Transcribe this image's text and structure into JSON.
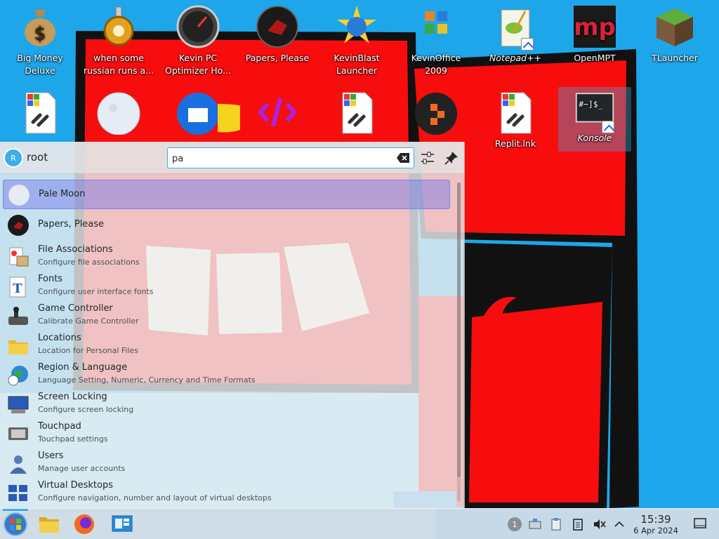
{
  "desktop": {
    "icons_row1": [
      {
        "label": "Big Money\nDeluxe",
        "icon": "money-bag-icon"
      },
      {
        "label": "when some\nrussian runs a...",
        "icon": "gear-settings-icon"
      },
      {
        "label": "Kevin PC\nOptimizer Ho...",
        "icon": "speedometer-icon"
      },
      {
        "label": "Papers, Please",
        "icon": "papers-please-icon"
      },
      {
        "label": "KevinBlast\nLauncher",
        "icon": "globe-star-icon"
      },
      {
        "label": "KevinOffice\n2009",
        "icon": "office-logo-icon"
      },
      {
        "label": "Notepad++",
        "icon": "notepad-plus-icon"
      },
      {
        "label": "OpenMPT",
        "icon": "openmpt-icon"
      },
      {
        "label": "TLauncher",
        "icon": "grass-block-icon"
      }
    ],
    "icons_row2": [
      {
        "label": "",
        "icon": "windows-link-file-icon"
      },
      {
        "label": "",
        "icon": "pale-moon-icon"
      },
      {
        "label": "",
        "icon": "thunderbird-icon"
      },
      {
        "label": "",
        "icon": "replit-logo-icon"
      },
      {
        "label": "",
        "icon": "windows-link-file-icon"
      },
      {
        "label": "",
        "icon": "orange-dots-app-icon"
      },
      {
        "label": "Replit.lnk",
        "icon": "windows-link-file-icon"
      },
      {
        "label": "Konsole",
        "icon": "terminal-icon"
      }
    ]
  },
  "launcher": {
    "user": {
      "name": "root",
      "initial": "R"
    },
    "search": {
      "value": "pa",
      "placeholder": "Search…"
    },
    "results": [
      {
        "title": "Pale Moon",
        "subtitle": "",
        "icon": "pale-moon-icon"
      },
      {
        "title": "Papers, Please",
        "subtitle": "",
        "icon": "papers-please-icon"
      },
      {
        "title": "File Associations",
        "subtitle": "Configure file associations",
        "icon": "file-associations-icon"
      },
      {
        "title": "Fonts",
        "subtitle": "Configure user interface fonts",
        "icon": "fonts-icon"
      },
      {
        "title": "Game Controller",
        "subtitle": "Calibrate Game Controller",
        "icon": "game-controller-icon"
      },
      {
        "title": "Locations",
        "subtitle": "Location for Personal Files",
        "icon": "folder-icon"
      },
      {
        "title": "Region & Language",
        "subtitle": "Language Setting, Numeric, Currency and Time Formats",
        "icon": "globe-clock-icon"
      },
      {
        "title": "Screen Locking",
        "subtitle": "Configure screen locking",
        "icon": "screen-lock-icon"
      },
      {
        "title": "Touchpad",
        "subtitle": "Touchpad settings",
        "icon": "touchpad-icon"
      },
      {
        "title": "Users",
        "subtitle": "Manage user accounts",
        "icon": "users-icon"
      },
      {
        "title": "Virtual Desktops",
        "subtitle": "Configure navigation, number and layout of virtual desktops",
        "icon": "virtual-desktops-icon"
      }
    ]
  },
  "taskbar": {
    "apps": [
      "folder-icon",
      "firefox-icon",
      "control-panel-icon"
    ],
    "tray": {
      "notification_count": "1"
    },
    "clock": {
      "time": "15:39",
      "date": "6 Apr 2024"
    }
  },
  "colors": {
    "accent": "#3daee9",
    "highlight": "#7a86e6",
    "wallpaper_red": "#ff0000",
    "wallpaper_blue": "#1aa3e8"
  }
}
